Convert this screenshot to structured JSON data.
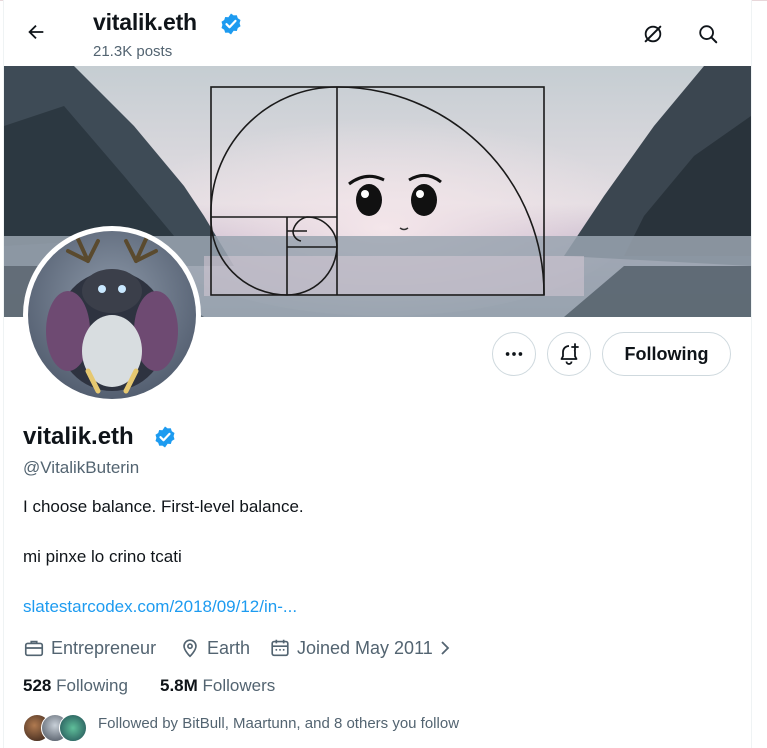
{
  "header": {
    "display_name": "vitalik.eth",
    "post_count": "21.3K posts"
  },
  "actions": {
    "following_label": "Following"
  },
  "profile": {
    "display_name": "vitalik.eth",
    "handle": "@VitalikButerin",
    "bio_line1": "I choose balance. First-level balance.",
    "bio_line2": "mi pinxe lo crino tcati",
    "link": "slatestarcodex.com/2018/09/12/in-...",
    "profession": "Entrepreneur",
    "location": "Earth",
    "joined": "Joined May 2011"
  },
  "stats": {
    "following_count": "528",
    "following_label": "Following",
    "followers_count": "5.8M",
    "followers_label": "Followers"
  },
  "followed_by": "Followed by BitBull, Maartunn, and 8 others you follow",
  "colors": {
    "accent": "#1d9bf0",
    "verified_badge": "#1d9bf0",
    "secondary_text": "#536471"
  },
  "icons": [
    "back-arrow-icon",
    "grok-icon",
    "search-icon",
    "more-icon",
    "notify-bell-icon",
    "verified-badge-icon",
    "briefcase-icon",
    "location-pin-icon",
    "calendar-icon",
    "chevron-right-icon"
  ]
}
